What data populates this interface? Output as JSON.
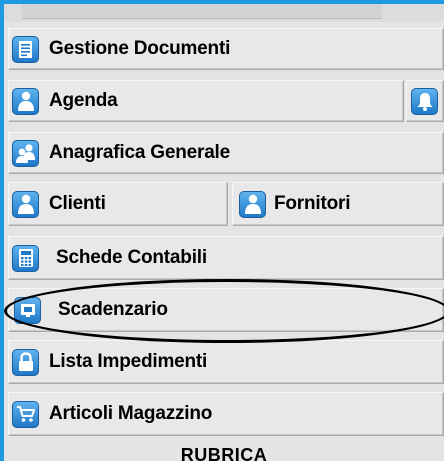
{
  "menu": {
    "gestione_documenti": "Gestione Documenti",
    "agenda": "Agenda",
    "anagrafica_generale": "Anagrafica Generale",
    "clienti": "Clienti",
    "fornitori": "Fornitori",
    "schede_contabili": "Schede Contabili",
    "scadenzario": "Scadenzario",
    "lista_impedimenti": "Lista Impedimenti",
    "articoli_magazzino": "Articoli Magazzino"
  },
  "footer": {
    "label": "RUBRICA"
  },
  "colors": {
    "accent": "#1e9be0",
    "icon_gradient_top": "#5fb3ef",
    "icon_gradient_bottom": "#1f78c8"
  }
}
